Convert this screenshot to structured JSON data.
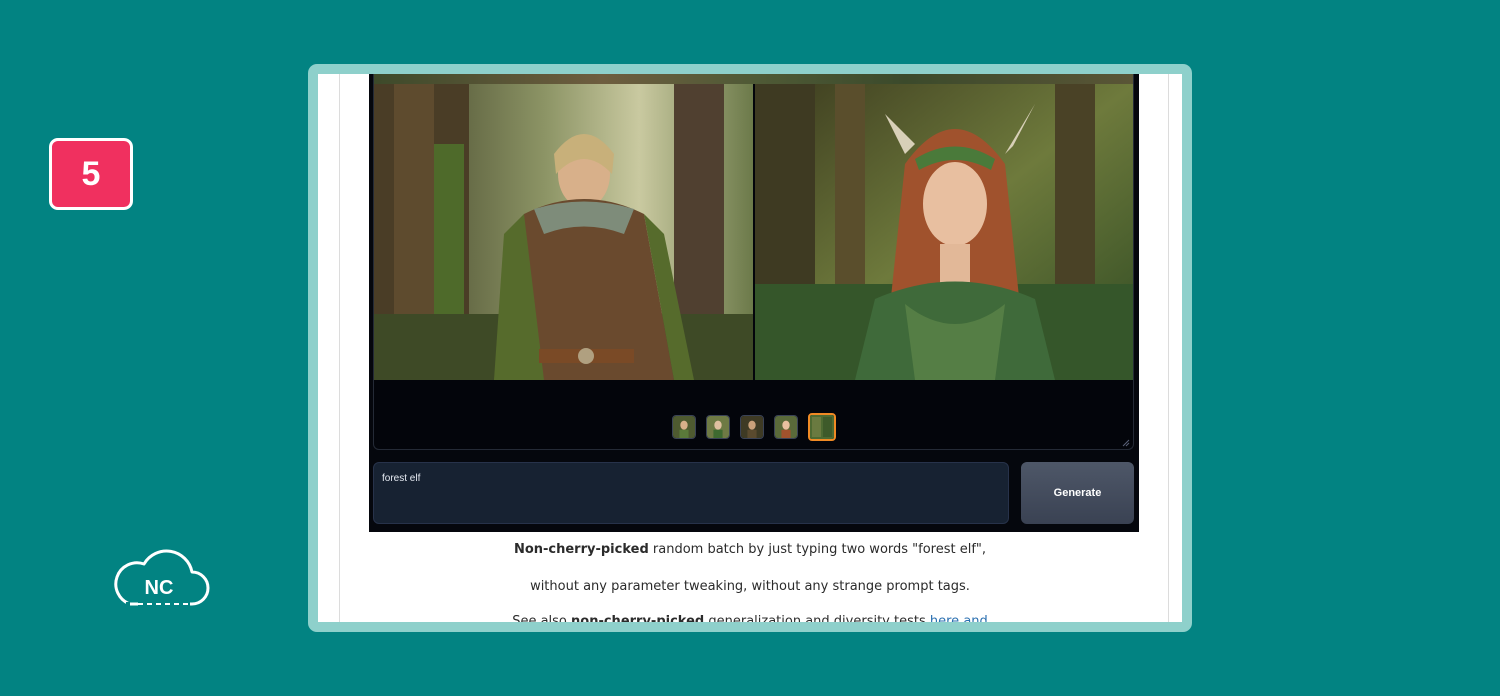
{
  "step_badge": "5",
  "logo_text": "NC",
  "app": {
    "prompt_value": "forest elf",
    "generate_label": "Generate",
    "thumbnails": [
      {
        "name": "thumb-1",
        "selected": false
      },
      {
        "name": "thumb-2",
        "selected": false
      },
      {
        "name": "thumb-3",
        "selected": false
      },
      {
        "name": "thumb-4",
        "selected": false
      },
      {
        "name": "thumb-5",
        "selected": true
      }
    ]
  },
  "caption": {
    "line1_bold": "Non-cherry-picked",
    "line1_rest": " random batch by just typing two words \"forest elf\",",
    "line2": "without any parameter tweaking, without any strange prompt tags.",
    "line3_start": "See also",
    "line3_bold": "non-cherry-picked",
    "line3_rest": "generalization and diversity tests",
    "line3_link": "here",
    "line3_link2": "and"
  },
  "colors": {
    "background": "#028382",
    "badge": "#f0305f",
    "frame": "#8ed0cb",
    "selected_thumb": "#f08a24",
    "generate_button": "#4e5768"
  }
}
